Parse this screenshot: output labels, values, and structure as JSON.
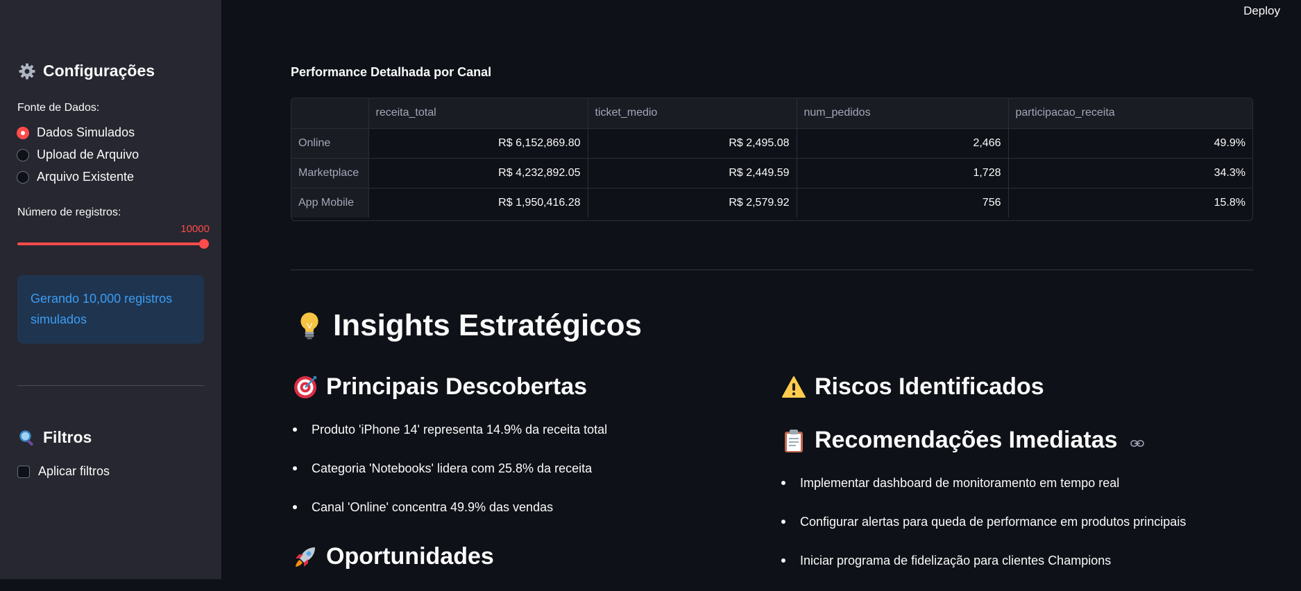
{
  "app": {
    "deploy_label": "Deploy"
  },
  "sidebar": {
    "config_title": "Configurações",
    "data_source_label": "Fonte de Dados:",
    "data_source_options": [
      "Dados Simulados",
      "Upload de Arquivo",
      "Arquivo Existente"
    ],
    "data_source_selected": "Dados Simulados",
    "records_label": "Número de registros:",
    "records_value": "10000",
    "records_slider_fraction": 1.0,
    "info_message": "Gerando 10,000 registros simulados",
    "filters_title": "Filtros",
    "apply_filters_label": "Aplicar filtros",
    "apply_filters_checked": false,
    "icons": {
      "config": "gear-icon",
      "filters": "magnifier-icon"
    }
  },
  "table": {
    "title": "Performance Detalhada por Canal",
    "columns": [
      "",
      "receita_total",
      "ticket_medio",
      "num_pedidos",
      "participacao_receita"
    ],
    "rows": [
      {
        "label": "Online",
        "receita_total": "R$ 6,152,869.80",
        "ticket_medio": "R$ 2,495.08",
        "num_pedidos": "2,466",
        "participacao_receita": "49.9%"
      },
      {
        "label": "Marketplace",
        "receita_total": "R$ 4,232,892.05",
        "ticket_medio": "R$ 2,449.59",
        "num_pedidos": "1,728",
        "participacao_receita": "34.3%"
      },
      {
        "label": "App Mobile",
        "receita_total": "R$ 1,950,416.28",
        "ticket_medio": "R$ 2,579.92",
        "num_pedidos": "756",
        "participacao_receita": "15.8%"
      }
    ]
  },
  "insights": {
    "title": "Insights Estratégicos",
    "discoveries_title": "Principais Descobertas",
    "discoveries": [
      "Produto 'iPhone 14' representa 14.9% da receita total",
      "Categoria 'Notebooks' lidera com 25.8% da receita",
      "Canal 'Online' concentra 49.9% das vendas"
    ],
    "opportunities_title": "Oportunidades",
    "risks_title": "Riscos Identificados",
    "recommendations_title": "Recomendações Imediatas",
    "recommendations": [
      "Implementar dashboard de monitoramento em tempo real",
      "Configurar alertas para queda de performance em produtos principais",
      "Iniciar programa de fidelização para clientes Champions"
    ],
    "icons": {
      "title": "lightbulb-icon",
      "discoveries": "target-icon",
      "opportunities": "rocket-icon",
      "risks": "warning-icon",
      "recommendations": "clipboard-icon"
    }
  },
  "colors": {
    "accent": "#ff4b4b",
    "background": "#0e1117",
    "sidebar": "#262730",
    "info_bg": "#1f344f",
    "info_text": "#3d9df3"
  }
}
